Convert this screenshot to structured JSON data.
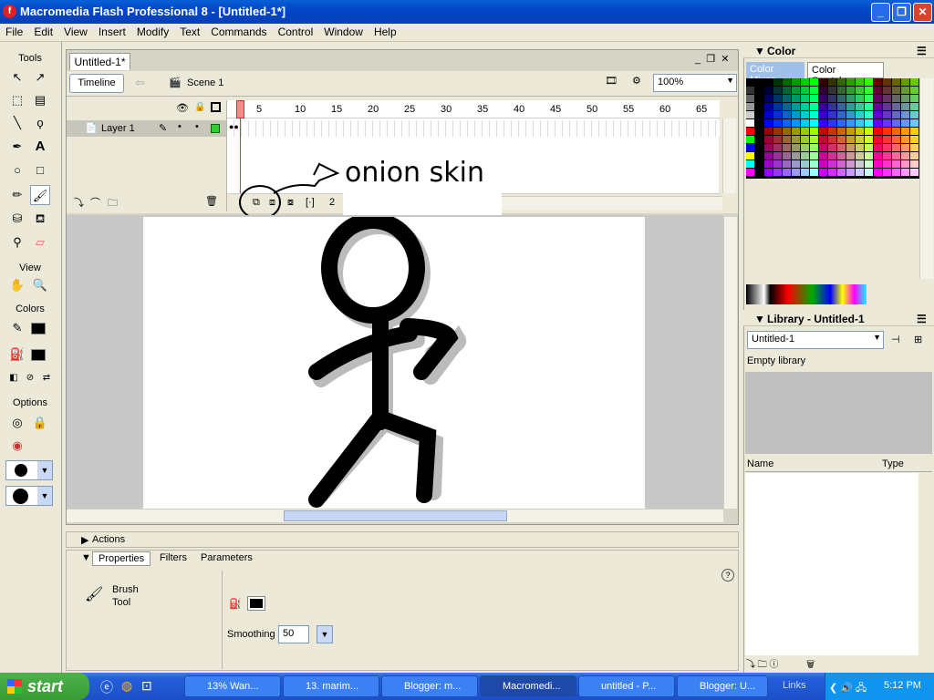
{
  "window": {
    "title": "Macromedia Flash Professional 8 - [Untitled-1*]",
    "app_icon": "flash-icon"
  },
  "menu": [
    "File",
    "Edit",
    "View",
    "Insert",
    "Modify",
    "Text",
    "Commands",
    "Control",
    "Window",
    "Help"
  ],
  "tools": {
    "header": "Tools",
    "view_label": "View",
    "colors_label": "Colors",
    "options_label": "Options"
  },
  "document": {
    "tab": "Untitled-1*",
    "timeline_button": "Timeline",
    "scene": "Scene 1",
    "zoom": "100%"
  },
  "timeline": {
    "layer_name": "Layer 1",
    "frame_numbers": [
      "5",
      "10",
      "15",
      "20",
      "25",
      "30",
      "35",
      "40",
      "45",
      "50",
      "55",
      "60",
      "65"
    ],
    "current_frame": "2",
    "annotation": "onion skin"
  },
  "color_panel": {
    "title": "Color",
    "tabs": [
      "Color Mixer",
      "Color Swatches"
    ]
  },
  "library_panel": {
    "title": "Library - Untitled-1",
    "selector": "Untitled-1",
    "empty_text": "Empty library",
    "col_name": "Name",
    "col_type": "Type"
  },
  "actions_panel": {
    "title": "Actions"
  },
  "properties_panel": {
    "tabs": [
      "Properties",
      "Filters",
      "Parameters"
    ],
    "tool_line1": "Brush",
    "tool_line2": "Tool",
    "smoothing_label": "Smoothing",
    "smoothing_value": "50"
  },
  "taskbar": {
    "start": "start",
    "tasks": [
      "13% Wan...",
      "13. marim...",
      "Blogger: m...",
      "Macromedi...",
      "untitled - P...",
      "Blogger: U..."
    ],
    "links": "Links",
    "clock": "5:12 PM"
  }
}
